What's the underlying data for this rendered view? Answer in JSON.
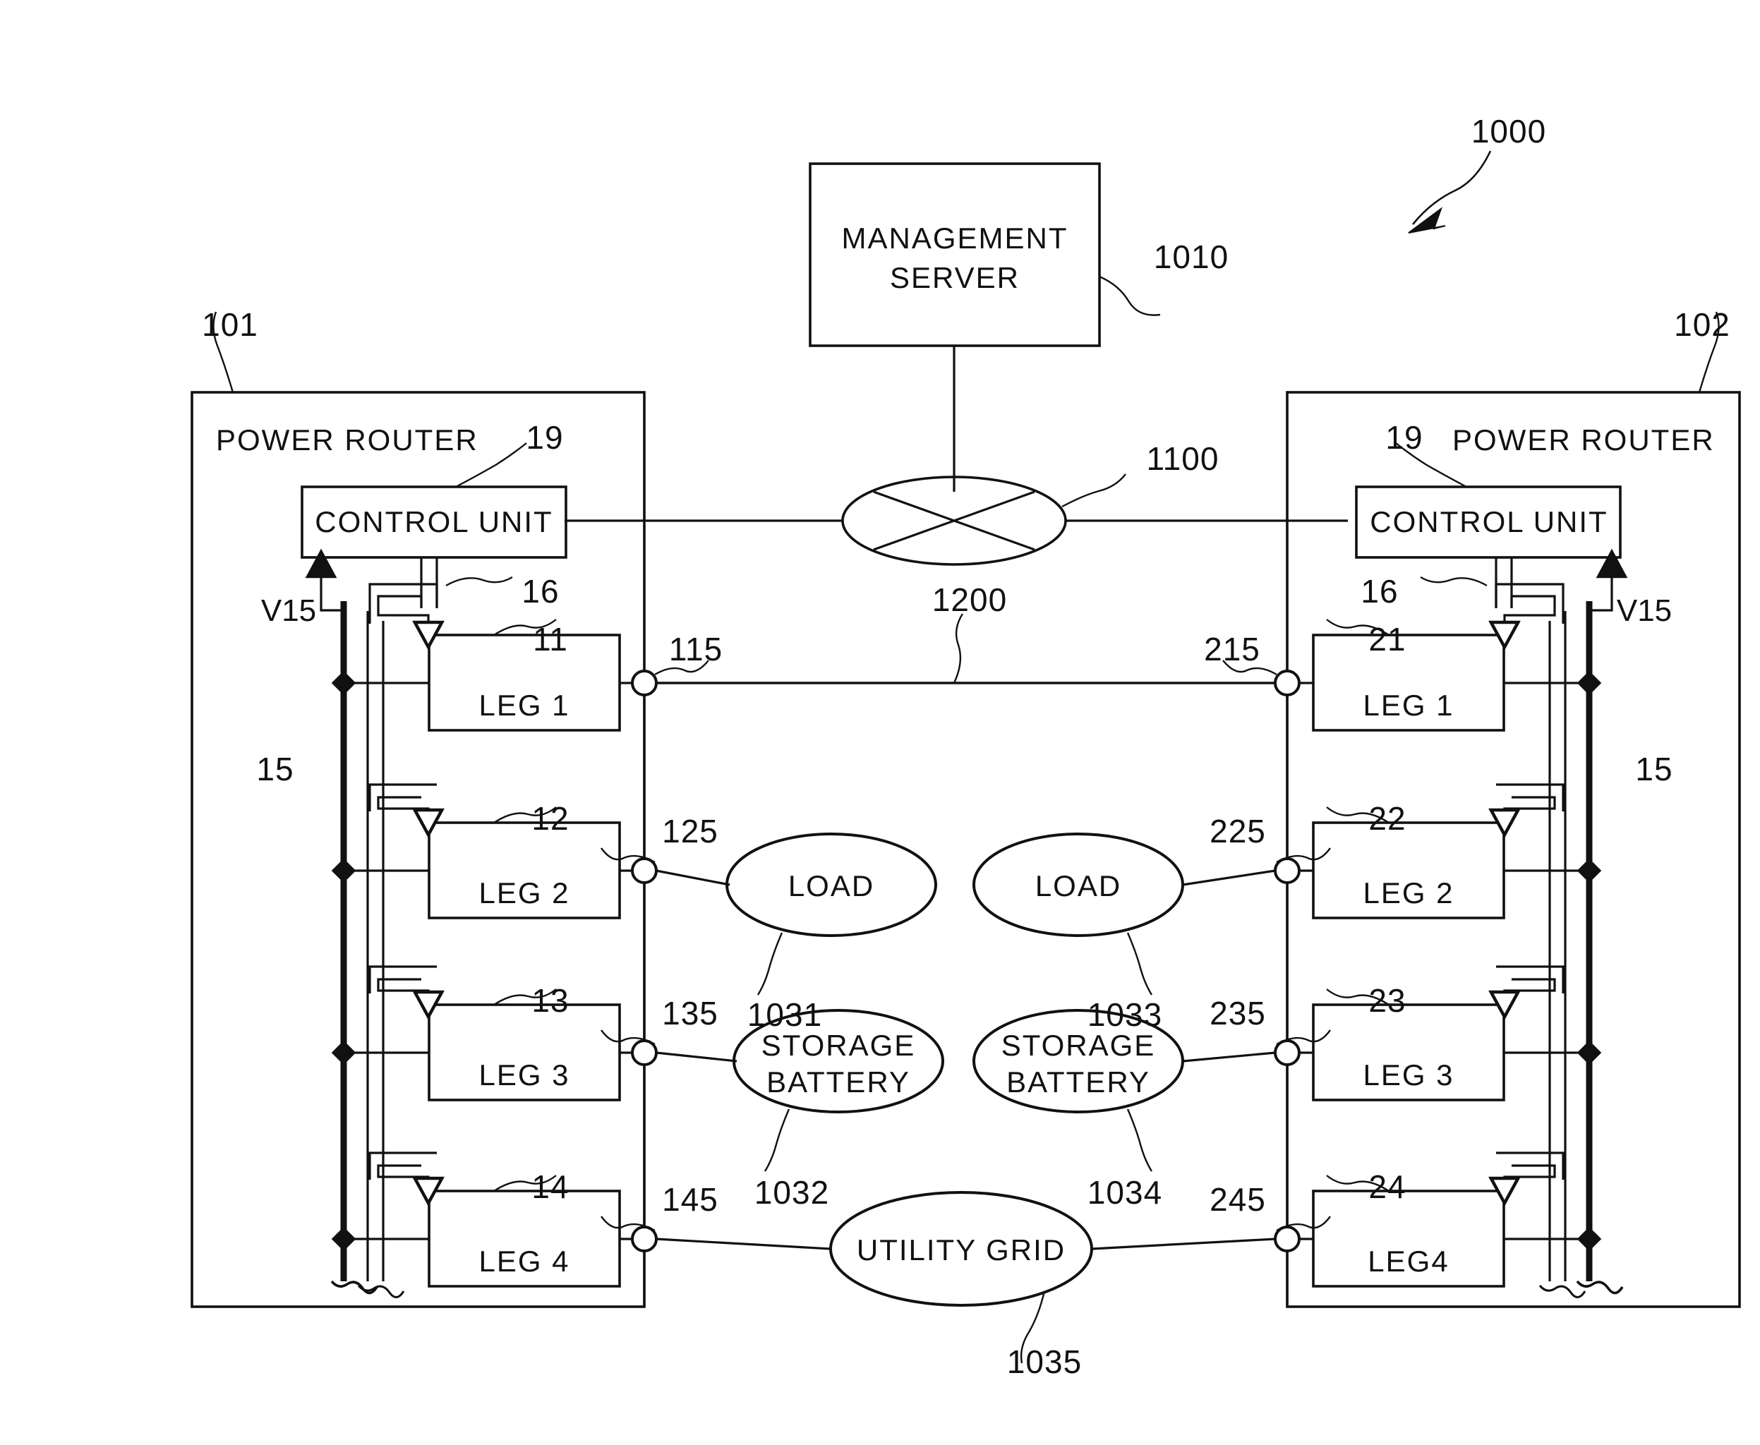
{
  "figure": {
    "type": "patent-block-diagram",
    "system_ref": "1000"
  },
  "management_server": {
    "label_line1": "MANAGEMENT",
    "label_line2": "SERVER",
    "ref": "1010"
  },
  "network": {
    "ref": "1100",
    "icon": "network-cloud-bowtie-icon"
  },
  "power_bus": {
    "ref": "1200"
  },
  "routers": [
    {
      "id": "left",
      "ref": "101",
      "title": "POWER ROUTER",
      "control_unit": {
        "label": "CONTROL UNIT",
        "ref": "19"
      },
      "switch_ref": "16",
      "bus_ref": "15",
      "voltage_label": "V15",
      "legs": [
        {
          "label": "LEG 1",
          "ref": "11",
          "port_ref": "115"
        },
        {
          "label": "LEG 2",
          "ref": "12",
          "port_ref": "125"
        },
        {
          "label": "LEG 3",
          "ref": "13",
          "port_ref": "135"
        },
        {
          "label": "LEG 4",
          "ref": "14",
          "port_ref": "145"
        }
      ]
    },
    {
      "id": "right",
      "ref": "102",
      "title": "POWER ROUTER",
      "control_unit": {
        "label": "CONTROL UNIT",
        "ref": "19"
      },
      "switch_ref": "16",
      "bus_ref": "15",
      "voltage_label": "V15",
      "legs": [
        {
          "label": "LEG 1",
          "ref": "21",
          "port_ref": "215"
        },
        {
          "label": "LEG 2",
          "ref": "22",
          "port_ref": "225"
        },
        {
          "label": "LEG 3",
          "ref": "23",
          "port_ref": "235"
        },
        {
          "label": "LEG4",
          "ref": "24",
          "port_ref": "245"
        }
      ]
    }
  ],
  "devices": [
    {
      "name": "load-left",
      "label": "LOAD",
      "label2": "",
      "ref": "1031"
    },
    {
      "name": "load-right",
      "label": "LOAD",
      "label2": "",
      "ref": "1033"
    },
    {
      "name": "battery-left",
      "label": "STORAGE",
      "label2": "BATTERY",
      "ref": "1032"
    },
    {
      "name": "battery-right",
      "label": "STORAGE",
      "label2": "BATTERY",
      "ref": "1034"
    },
    {
      "name": "utility-grid",
      "label": "UTILITY GRID",
      "label2": "",
      "ref": "1035"
    }
  ],
  "colors": {
    "line": "#111111",
    "background": "#ffffff"
  }
}
